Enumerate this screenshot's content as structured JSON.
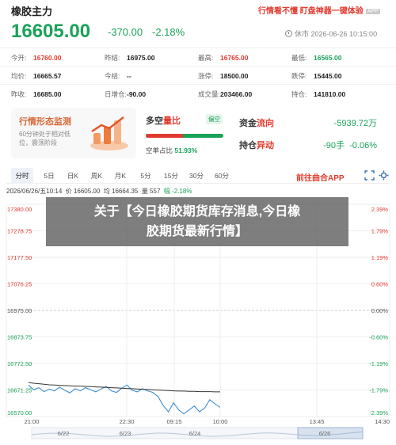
{
  "header": {
    "title": "橡胶主力",
    "promo": "行情看不懂 盯盘神器一键体验",
    "promo_badge": "APP"
  },
  "quote": {
    "price": "16605.00",
    "change": "-370.00",
    "change_pct": "-2.18%",
    "status": "休市 2026-06-26 10:15:00"
  },
  "stats": [
    [
      {
        "label": "今开:",
        "value": "16760.00",
        "color": "red"
      },
      {
        "label": "昨结:",
        "value": "16975.00",
        "color": "normal"
      },
      {
        "label": "最高:",
        "value": "16765.00",
        "color": "red"
      },
      {
        "label": "最低:",
        "value": "16565.00",
        "color": "green"
      }
    ],
    [
      {
        "label": "均价:",
        "value": "16665.57",
        "color": "normal"
      },
      {
        "label": "今结:",
        "value": "--",
        "color": "normal"
      },
      {
        "label": "涨停:",
        "value": "18500.00",
        "color": "normal"
      },
      {
        "label": "跌停:",
        "value": "15445.00",
        "color": "normal"
      }
    ],
    [
      {
        "label": "昨收:",
        "value": "16685.00",
        "color": "normal"
      },
      {
        "label": "日增仓:",
        "value": "-90.00",
        "color": "normal"
      },
      {
        "label": "成交量:",
        "value": "203466.00",
        "color": "normal"
      },
      {
        "label": "持仓:",
        "value": "141810.00",
        "color": "normal"
      }
    ]
  ],
  "cards": {
    "pattern_title": "行情形态监测",
    "pattern_desc": "60分钟处于相对低位，震荡阶段",
    "longshort_title_a": "多空",
    "longshort_title_b": "量比",
    "longshort_tag": "偏空",
    "short_ratio_label": "空单占比",
    "short_ratio_value": "51.93%",
    "short_ratio": 0.5193,
    "capital_title_a": "资金",
    "capital_title_b": "流向",
    "capital_value": "-5939.72万",
    "position_title_a": "持仓",
    "position_title_b": "异动",
    "position_value": "-90手",
    "position_pct": "-0.06%"
  },
  "tabs": [
    "分时",
    "5日",
    "日K",
    "周K",
    "月K",
    "5分",
    "15分",
    "30分",
    "60分"
  ],
  "tab_app": "前往曲合APP",
  "info_line": {
    "time": "2026/06/26/五10:14",
    "price": "价 16605.00",
    "avg": "均 16664.35",
    "vol": "量 557",
    "pct": "幅 -2.18%"
  },
  "overlay": {
    "line1": "关于【今日橡胶期货库存消息,今日橡",
    "line2": "胶期货最新行情】"
  },
  "colors": {
    "up": "#e23a2e",
    "down": "#1aa259",
    "avg_line": "#333333",
    "price_line": "#3d8fd1"
  },
  "chart_data": {
    "type": "line",
    "y_labels_left": [
      "17380.00",
      "17278.75",
      "17177.50",
      "17076.25",
      "16975.00",
      "16873.75",
      "16772.50",
      "16671.25",
      "16570.00"
    ],
    "y_labels_right": [
      "2.39%",
      "1.79%",
      "1.19%",
      "0.60%",
      "0.00%",
      "-0.60%",
      "-1.19%",
      "-1.79%",
      "-2.39%"
    ],
    "ylim": [
      16570,
      17380
    ],
    "x_ticks": [
      "21:00",
      "22:30",
      "09:15",
      "10:00",
      "13:45",
      "14:30"
    ],
    "nav_dates": [
      "6/22",
      "6/23",
      "6/24",
      "6/26"
    ],
    "series": [
      {
        "kind": "price",
        "values": [
          16690,
          16672,
          16680,
          16665,
          16675,
          16668,
          16682,
          16670,
          16660,
          16676,
          16668,
          16680,
          16672,
          16664,
          16675,
          16685,
          16668,
          16662,
          16678,
          16690,
          16670,
          16664,
          16676,
          16668,
          16662,
          16646,
          16612,
          16588,
          16622,
          16595,
          16580,
          16595,
          16610,
          16588,
          16602,
          16634,
          16618,
          16605
        ]
      },
      {
        "kind": "avg",
        "values": [
          16700,
          16697,
          16695,
          16693,
          16691,
          16690,
          16689,
          16688,
          16687,
          16686,
          16686,
          16685,
          16684,
          16683,
          16682,
          16681,
          16680,
          16679,
          16678,
          16677,
          16676,
          16675,
          16674,
          16673,
          16672,
          16671,
          16670,
          16669,
          16668,
          16667,
          16667,
          16666,
          16666,
          16665,
          16665,
          16665,
          16664,
          16664
        ]
      }
    ]
  }
}
